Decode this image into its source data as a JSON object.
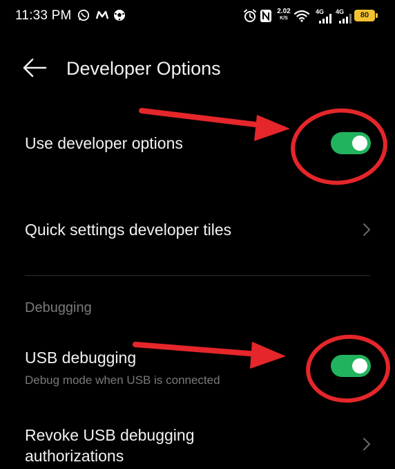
{
  "status_bar": {
    "time": "11:33 PM",
    "net_speed_value": "2.02",
    "net_speed_unit": "K/S",
    "signal_1_label": "4G",
    "signal_2_label": "4G",
    "battery": "80",
    "icons": [
      "whatsapp-icon",
      "app-notification-icon",
      "football-icon",
      "alarm-icon",
      "nfc-icon",
      "wifi-icon",
      "signal-icon",
      "battery-icon"
    ],
    "battery_color": "#f2c230"
  },
  "header": {
    "title": "Developer Options"
  },
  "settings": {
    "use_developer_options": {
      "label": "Use developer options",
      "enabled": true
    },
    "quick_settings_tiles": {
      "label": "Quick settings developer tiles"
    },
    "debugging_section": {
      "label": "Debugging"
    },
    "usb_debugging": {
      "label": "USB debugging",
      "description": "Debug mode when USB is connected",
      "enabled": true
    },
    "revoke_usb": {
      "label_line1": "Revoke USB debugging",
      "label_line2": "authorizations"
    }
  },
  "colors": {
    "background": "#000000",
    "toggle_on": "#22b35e",
    "annotation": "#e5262a",
    "secondary_text": "#7a7a7a"
  }
}
